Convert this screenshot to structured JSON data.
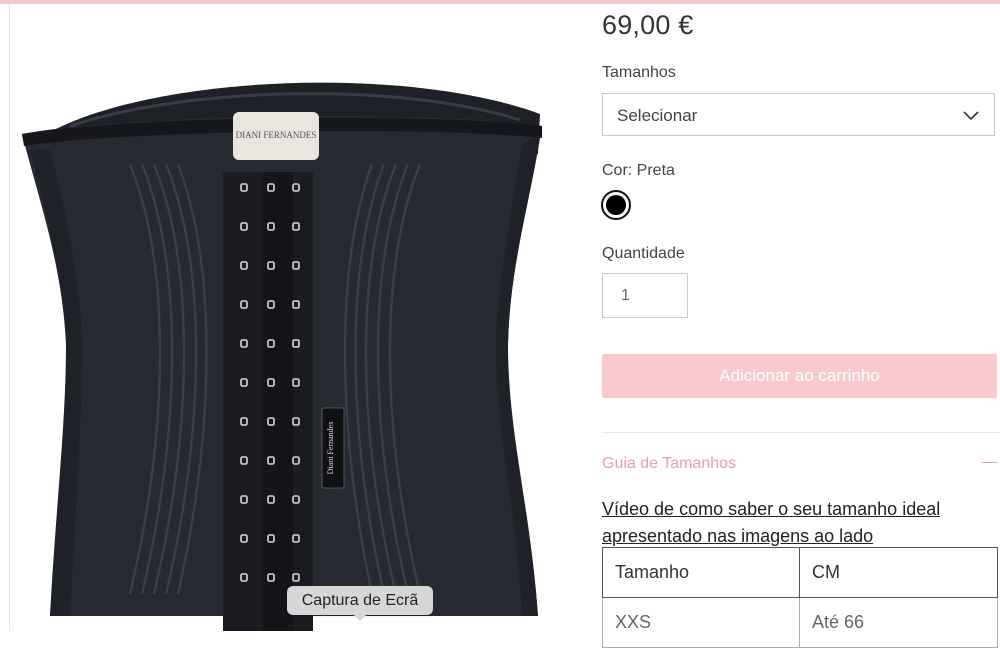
{
  "product": {
    "price": "69,00 €",
    "size_label": "Tamanhos",
    "size_select_value": "Selecionar",
    "color_label": "Cor: Preta",
    "color_swatch": "#000000",
    "quantity_label": "Quantidade",
    "quantity_value": "1",
    "add_to_cart_label": "Adicionar ao carrinho",
    "add_to_cart_color": "#f8c9ce"
  },
  "guide": {
    "title": "Guia de Tamanhos",
    "toggle_icon": "minus-icon",
    "video_link": "Vídeo de como saber o seu tamanho ideal apresentado nas imagens ao lado",
    "table_headers": [
      "Tamanho",
      "CM"
    ],
    "table_rows": [
      [
        "XXS",
        "Até 66"
      ]
    ]
  },
  "image": {
    "brand_text": "DIANI FERNANDES",
    "label_text": "Diani Fernandes"
  },
  "tooltip": {
    "text": "Captura de Ecrã"
  },
  "colors": {
    "accent_pink": "#e8a0a9",
    "button_pink": "#f8c9ce",
    "garment": "#272a33"
  }
}
